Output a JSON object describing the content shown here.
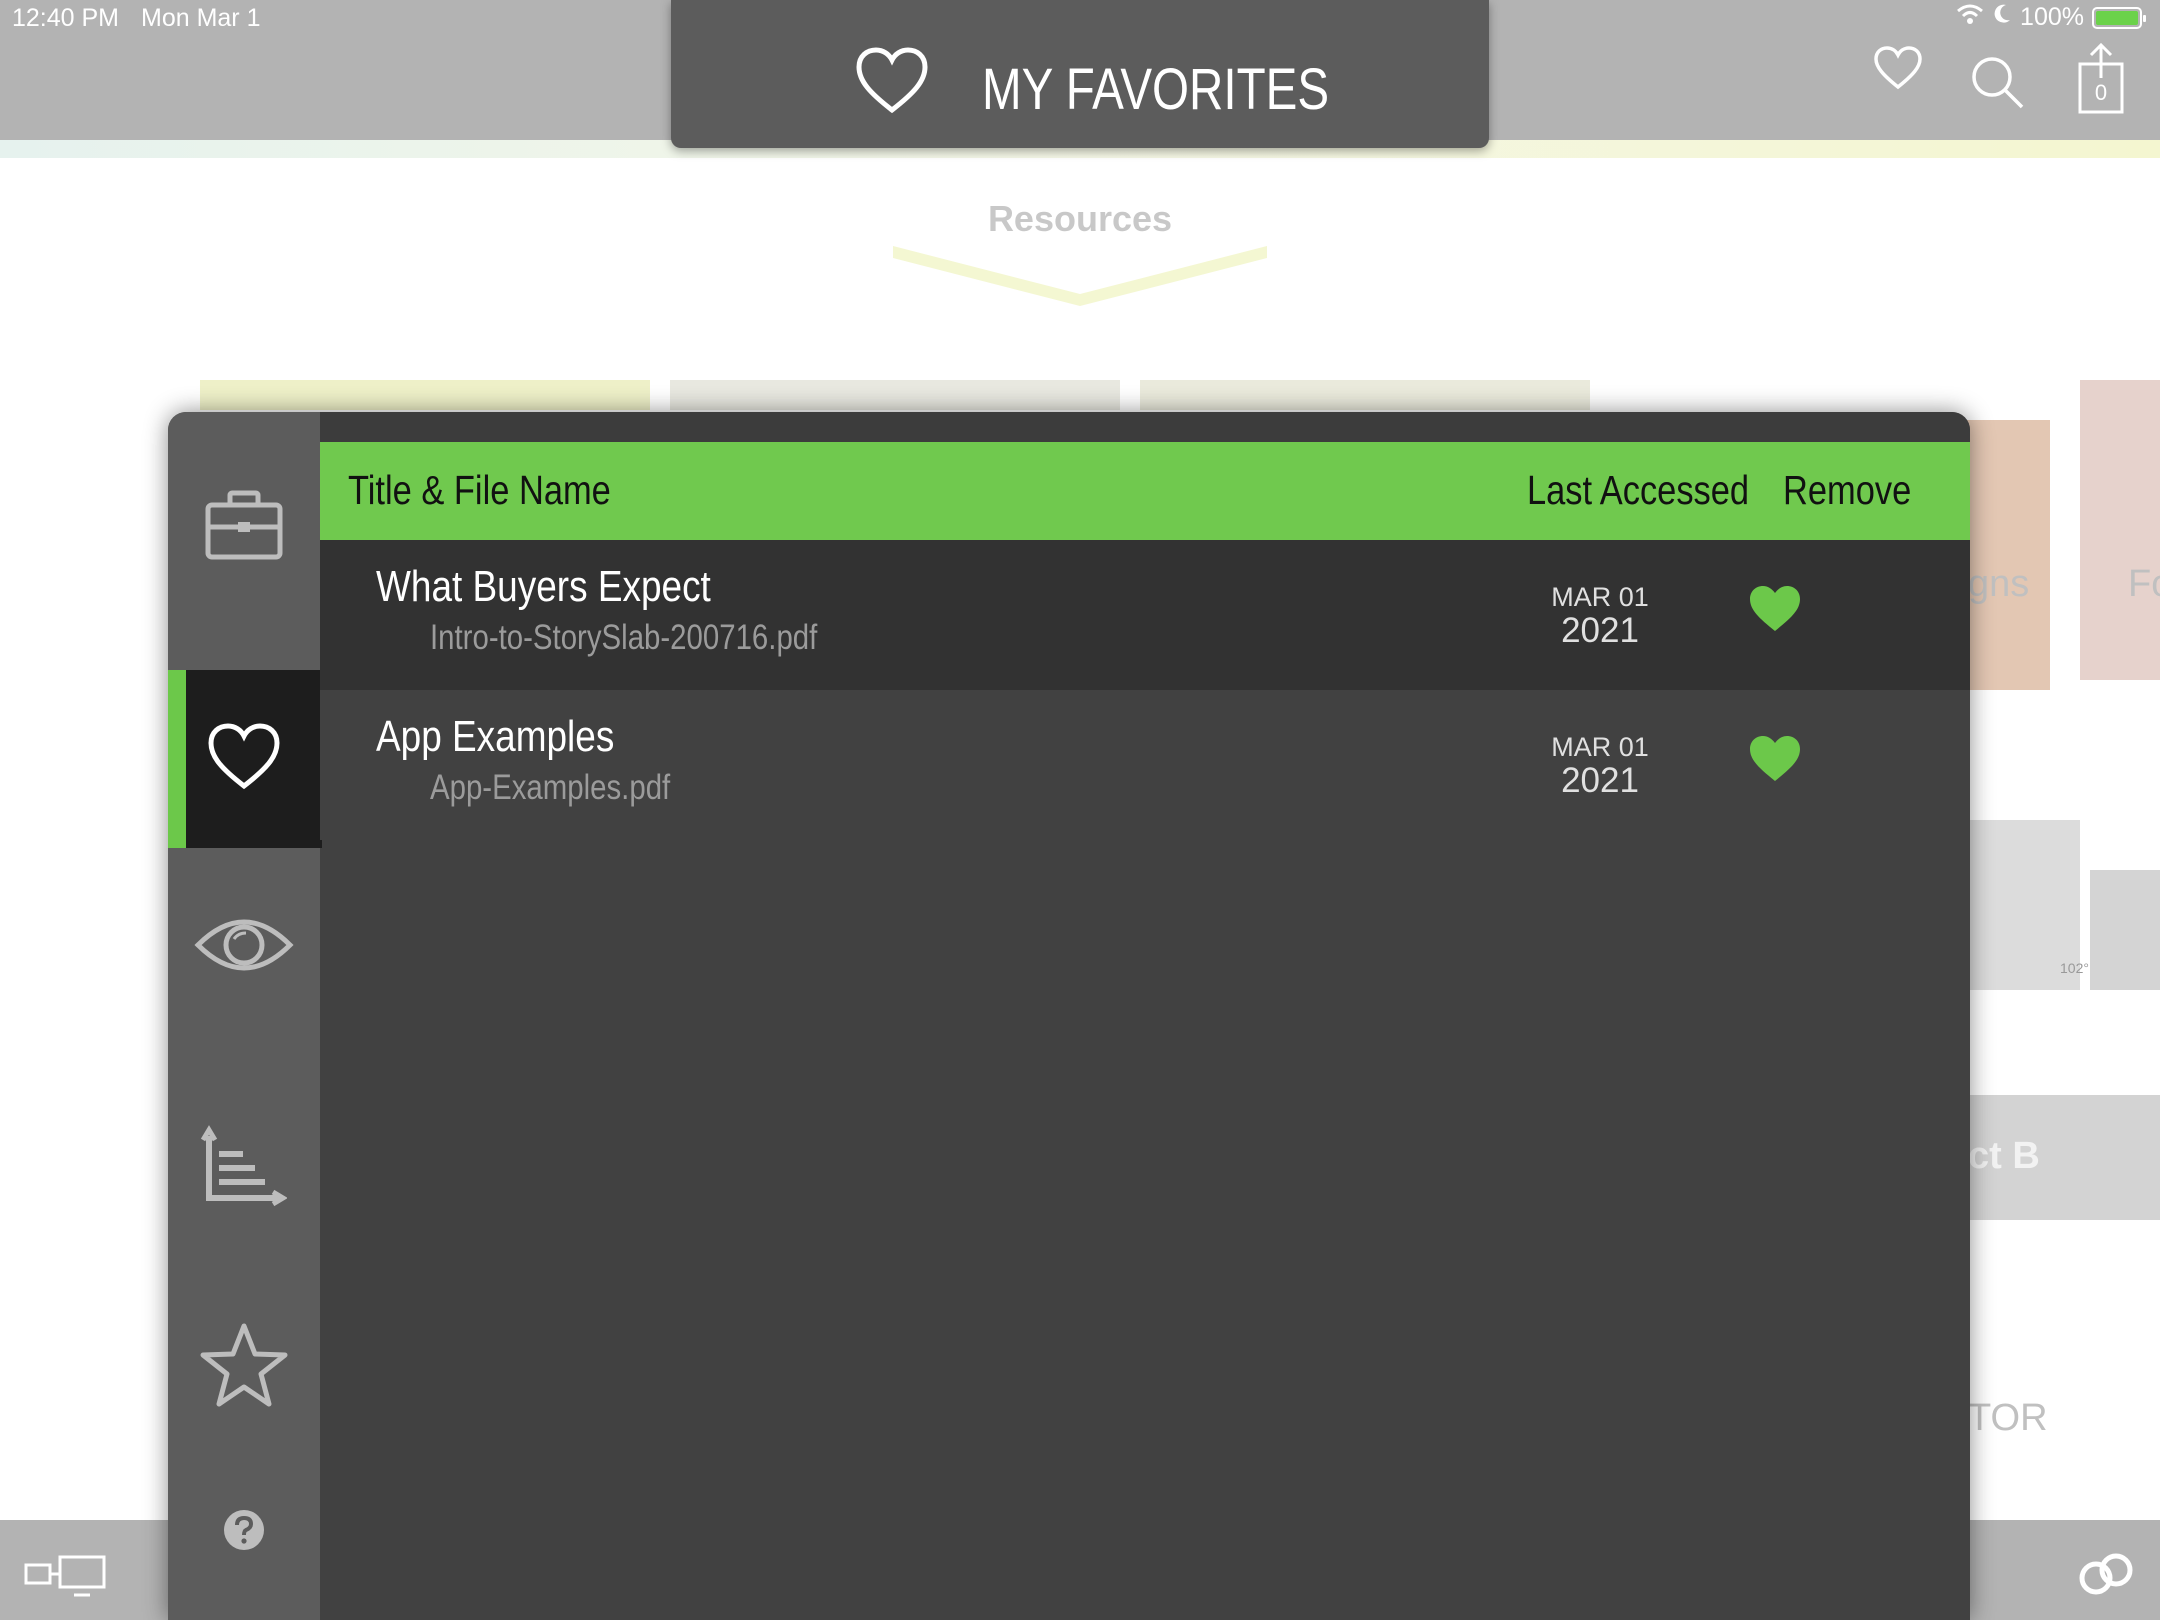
{
  "status_bar": {
    "time": "12:40 PM",
    "date": "Mon Mar 1",
    "battery": "100%"
  },
  "header": {
    "title": "MY FAVORITES",
    "title_icon": "heart-outline-icon",
    "actions": [
      "heart-icon",
      "search-icon",
      "share-icon"
    ],
    "share_count": "0"
  },
  "background": {
    "tab_label": "Resources",
    "partial_texts": [
      "gns",
      "Fo",
      "ct B",
      "TOR",
      "102°"
    ]
  },
  "sidebar": {
    "items": [
      {
        "icon": "briefcase-icon",
        "active": false
      },
      {
        "icon": "heart-icon",
        "active": true
      },
      {
        "icon": "eye-icon",
        "active": false
      },
      {
        "icon": "chart-icon",
        "active": false
      },
      {
        "icon": "star-icon",
        "active": false
      },
      {
        "icon": "help-icon",
        "active": false
      }
    ]
  },
  "table": {
    "columns": {
      "title": "Title & File Name",
      "last_accessed": "Last Accessed",
      "remove": "Remove"
    },
    "rows": [
      {
        "title": "What Buyers Expect",
        "file": "Intro-to-StorySlab-200716.pdf",
        "month": "MAR 01",
        "year": "2021"
      },
      {
        "title": "App Examples",
        "file": "App-Examples.pdf",
        "month": "MAR 01",
        "year": "2021"
      }
    ]
  },
  "colors": {
    "accent": "#70c94e",
    "header_bg": "#5c5c5c",
    "modal_bg": "#414141",
    "row_alt_bg": "#323232",
    "active_sidebar_bg": "#1d1d1d"
  }
}
